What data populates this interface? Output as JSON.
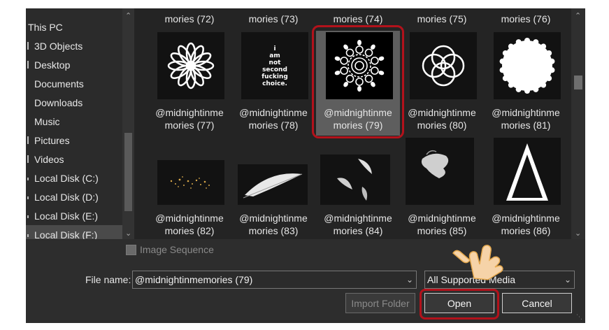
{
  "sidebar": {
    "items": [
      {
        "label": "This PC"
      },
      {
        "label": "3D Objects"
      },
      {
        "label": "Desktop"
      },
      {
        "label": "Documents"
      },
      {
        "label": "Downloads"
      },
      {
        "label": "Music"
      },
      {
        "label": "Pictures"
      },
      {
        "label": "Videos"
      },
      {
        "label": "Local Disk (C:)"
      },
      {
        "label": "Local Disk (D:)"
      },
      {
        "label": "Local Disk (E:)"
      },
      {
        "label": "Local Disk (F:)"
      }
    ]
  },
  "grid": {
    "top_row_captions": [
      "mories (72)",
      "mories (73)",
      "mories (74)",
      "mories (75)",
      "mories (76)"
    ],
    "files": [
      {
        "line1": "@midnightinme",
        "line2": "mories (77)",
        "icon": "mandala-flower-icon"
      },
      {
        "line1": "@midnightinme",
        "line2": "mories (78)",
        "icon": "typography-text-icon",
        "thumb_text": [
          "i",
          "am",
          "not",
          "second",
          "fucking",
          "choice."
        ]
      },
      {
        "line1": "@midnightinme",
        "line2": "mories (79)",
        "icon": "mandala-lace-icon",
        "selected": true
      },
      {
        "line1": "@midnightinme",
        "line2": "mories (80)",
        "icon": "interlocking-rings-icon"
      },
      {
        "line1": "@midnightinme",
        "line2": "mories (81)",
        "icon": "scalloped-circle-icon"
      },
      {
        "line1": "@midnightinme",
        "line2": "mories (82)",
        "icon": "sparkle-dust-icon"
      },
      {
        "line1": "@midnightinme",
        "line2": "mories (83)",
        "icon": "feather-icon"
      },
      {
        "line1": "@midnightinme",
        "line2": "mories (84)",
        "icon": "falling-feathers-icon"
      },
      {
        "line1": "@midnightinme",
        "line2": "mories (85)",
        "icon": "smoke-splash-icon"
      },
      {
        "line1": "@midnightinme",
        "line2": "mories (86)",
        "icon": "triangle-outline-icon"
      }
    ]
  },
  "footer": {
    "image_sequence_label": "Image Sequence",
    "file_name_label": "File name:",
    "file_name_value": "@midnightinmemories (79)",
    "file_type_value": "All Supported Media",
    "import_folder_label": "Import Folder",
    "open_label": "Open",
    "cancel_label": "Cancel"
  },
  "colors": {
    "highlight_ring": "#b3121b",
    "dialog_bg": "#2d2d2d",
    "grid_bg": "#242424"
  }
}
